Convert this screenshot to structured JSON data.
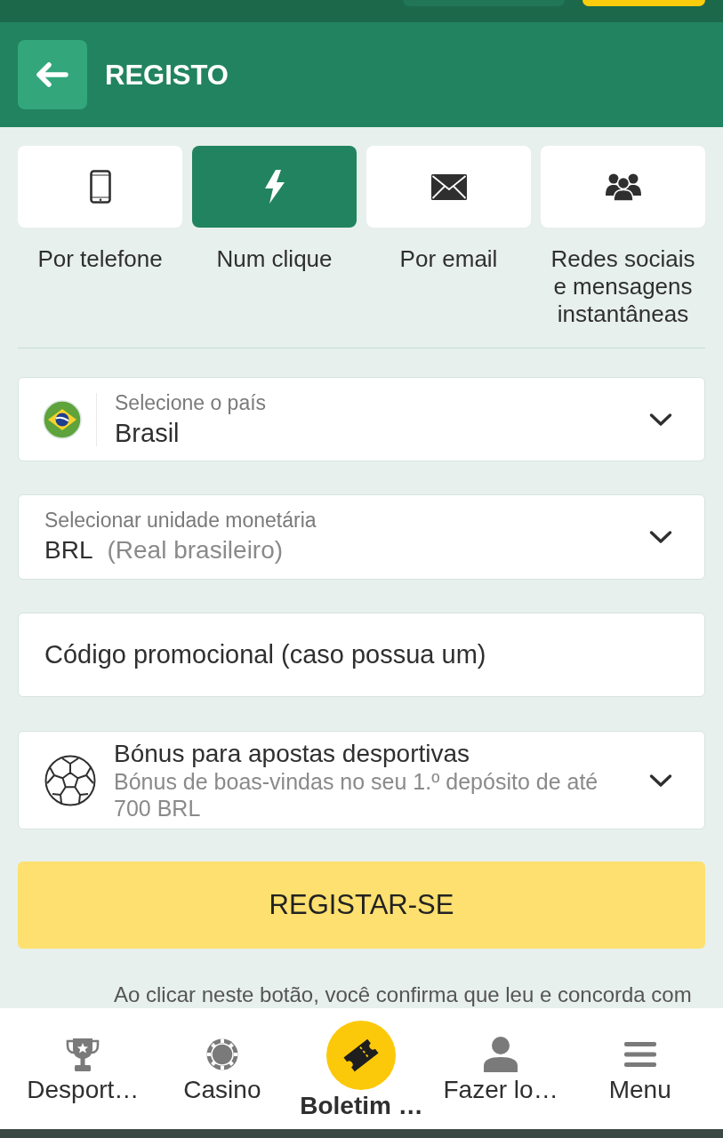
{
  "top_bar": {
    "buttons": [
      {
        "kind": "secondary"
      },
      {
        "kind": "primary"
      }
    ]
  },
  "header": {
    "title": "REGISTO"
  },
  "methods": [
    {
      "kind": "phone",
      "label": "Por telefone",
      "selected": false
    },
    {
      "kind": "one_click",
      "label": "Num clique",
      "selected": true
    },
    {
      "kind": "email",
      "label": "Por email",
      "selected": false
    },
    {
      "kind": "social",
      "label": "Redes sociais e mensagens instantâneas",
      "selected": false
    }
  ],
  "form": {
    "country": {
      "label": "Selecione o país",
      "value": "Brasil"
    },
    "currency": {
      "label": "Selecionar unidade monetária",
      "code": "BRL",
      "name": "(Real brasileiro)"
    },
    "promo_code": {
      "placeholder": "Código promocional (caso possua um)"
    },
    "bonus": {
      "title": "Bónus para apostas desportivas",
      "description": "Bónus de boas-vindas no seu 1.º depósito de até 700 BRL"
    }
  },
  "submit_button": "REGISTAR-SE",
  "disclaimer": "Ao clicar neste botão, você confirma que leu e concorda com",
  "bottom_nav": [
    {
      "kind": "sports",
      "label": "Desport…"
    },
    {
      "kind": "casino",
      "label": "Casino"
    },
    {
      "kind": "betslip",
      "label": "Boletim …"
    },
    {
      "kind": "login",
      "label": "Fazer lo…"
    },
    {
      "kind": "menu",
      "label": "Menu"
    }
  ]
}
